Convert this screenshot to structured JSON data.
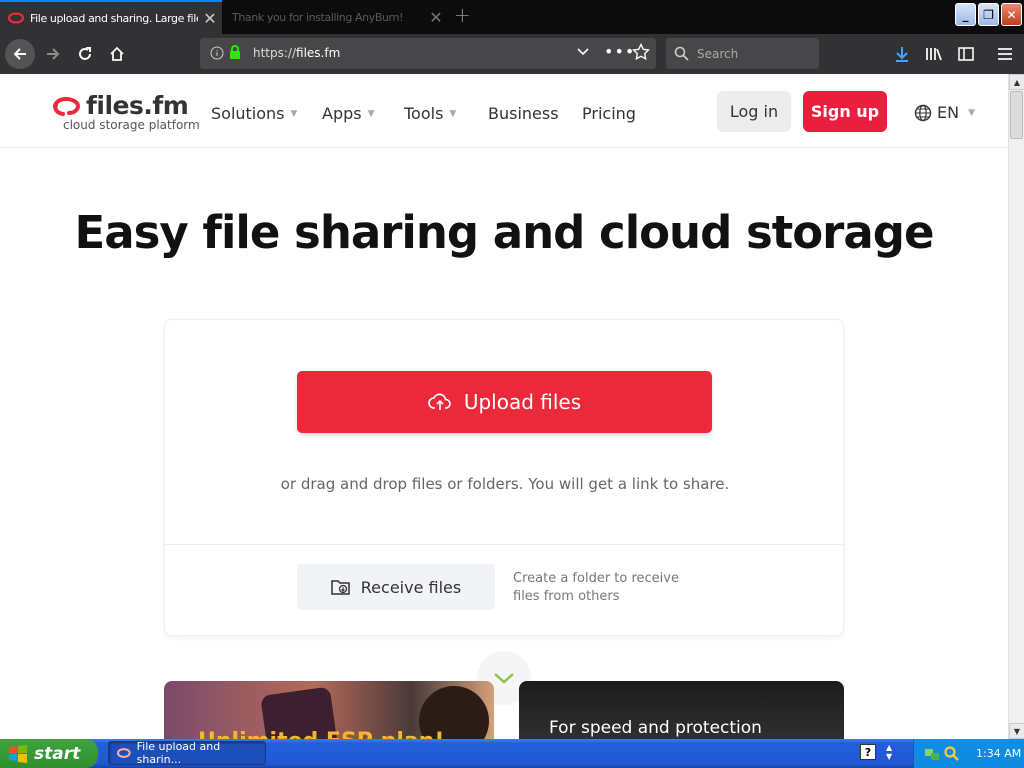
{
  "browser": {
    "tabs": [
      {
        "title": "File upload and sharing. Large file",
        "active": true
      },
      {
        "title": "Thank you for installing AnyBurn!",
        "active": false
      }
    ],
    "url_prefix": "https://",
    "url_domain": "files.fm",
    "search_placeholder": "Search"
  },
  "site": {
    "logo_name": "files.fm",
    "logo_tagline": "cloud storage platform",
    "nav": {
      "solutions": "Solutions",
      "apps": "Apps",
      "tools": "Tools",
      "business": "Business",
      "pricing": "Pricing"
    },
    "login": "Log in",
    "signup": "Sign up",
    "language": "EN",
    "brand_color": "#ea1f3d"
  },
  "hero": {
    "title": "Easy file sharing and cloud storage"
  },
  "upload_card": {
    "upload_label": "Upload files",
    "drag_text": "or drag and drop files or folders. You will get a link to share.",
    "receive_label": "Receive files",
    "receive_desc": "Create a folder to receive files from others"
  },
  "features": {
    "card1_text": "Unlimited FSP plan!",
    "card2_text": "For speed and protection"
  },
  "taskbar": {
    "start": "start",
    "window_item": "File upload and sharin...",
    "clock": "1:34 AM"
  }
}
